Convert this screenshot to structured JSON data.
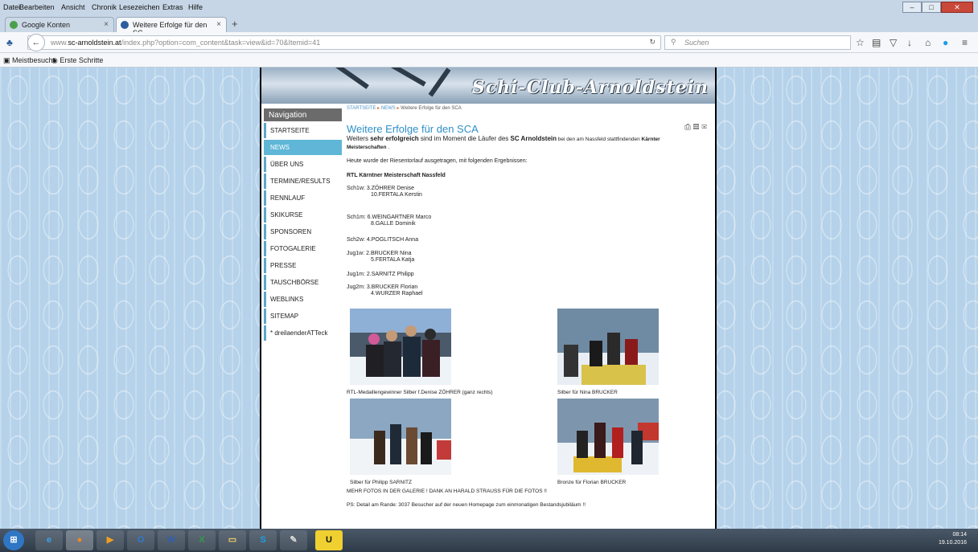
{
  "browser": {
    "menu": [
      "Datei",
      "Bearbeiten",
      "Ansicht",
      "Chronik",
      "Lesezeichen",
      "Extras",
      "Hilfe"
    ],
    "tabs": [
      {
        "label": "Google Konten",
        "active": false
      },
      {
        "label": "Weitere Erfolge für den SC...",
        "active": true
      }
    ],
    "url_prefix": "www.",
    "url_host": "sc-arnoldstein.at",
    "url_path": "/index.php?option=com_content&task=view&id=70&Itemid=41",
    "search_placeholder": "Suchen",
    "bookmarks": [
      "Meistbesucht",
      "Erste Schritte"
    ]
  },
  "site": {
    "title": "Schi-Club-Arnoldstein",
    "nav_header": "Navigation",
    "nav_items": [
      {
        "label": "STARTSEITE",
        "active": false
      },
      {
        "label": "NEWS",
        "active": true
      },
      {
        "label": "ÜBER UNS",
        "active": false
      },
      {
        "label": "TERMINE/RESULTS",
        "active": false
      },
      {
        "label": "RENNLAUF",
        "active": false
      },
      {
        "label": "SKIKURSE",
        "active": false
      },
      {
        "label": "SPONSOREN",
        "active": false
      },
      {
        "label": "FOTOGALERIE",
        "active": false
      },
      {
        "label": "PRESSE",
        "active": false
      },
      {
        "label": "TAUSCHBÖRSE",
        "active": false
      },
      {
        "label": "WEBLINKS",
        "active": false
      },
      {
        "label": "SITEMAP",
        "active": false
      },
      {
        "label": "* dreilaenderATTeck",
        "active": false
      }
    ],
    "breadcrumb": [
      "STARTSEITE",
      "NEWS",
      "Weitere Erfolge für den SCA"
    ]
  },
  "article": {
    "title": "Weitere Erfolge für den SCA",
    "intro_a": "Weiters ",
    "intro_b": "sehr erfolgreich",
    "intro_c": " sind im Moment die Läufer des ",
    "intro_d": "SC Arnoldstein",
    "intro_e": " bei den am Nassfeld stattfindenden ",
    "intro_f": "Kärnter Meisterschaften",
    "intro_g": " .",
    "para1": "Heute wurde der Riesentorlauf ausgetragen, mit folgenden Ergebnissen:",
    "heading": "RTL Kärntner Meisterschaft Nassfeld",
    "results": [
      {
        "l1": "Sch1w:  3.ZÖHRER Denise",
        "l2": "10.FERTALA Kerstin"
      },
      {
        "l1": "Sch1m:  6.WEINGARTNER Marco",
        "l2": "8.GALLE Dominik"
      },
      {
        "l1": "Sch2w:  4.POGLITSCH Anna",
        "l2": ""
      },
      {
        "l1": "Jug1w:  2.BRUCKER Nina",
        "l2": "5.FERTALA Katja"
      },
      {
        "l1": "Jug1m: 2.SARNITZ Philipp",
        "l2": ""
      },
      {
        "l1": "Jug2m: 3.BRUCKER Florian",
        "l2": "4.WURZER Raphael"
      }
    ],
    "captions": [
      "RTL-Medaillengewinner   Silber f.Denise ZÖHRER (ganz rechts)",
      "Silber für Nina BRUCKER",
      "Silber für Philipp SARNITZ",
      "Bronze für Florian BRUCKER"
    ],
    "more_photos": "MEHR FOTOS IN DER GALERIE ! DANK AN HARALD STRAUSS FÜR DIE FOTOS !!",
    "ps": "PS: Detail am Rande: 3037 Besucher auf der neuen Homepage zum einmonatigen Bestandsjubiläum !!"
  },
  "taskbar": {
    "time": "08:14",
    "date": "19.10.2016"
  }
}
